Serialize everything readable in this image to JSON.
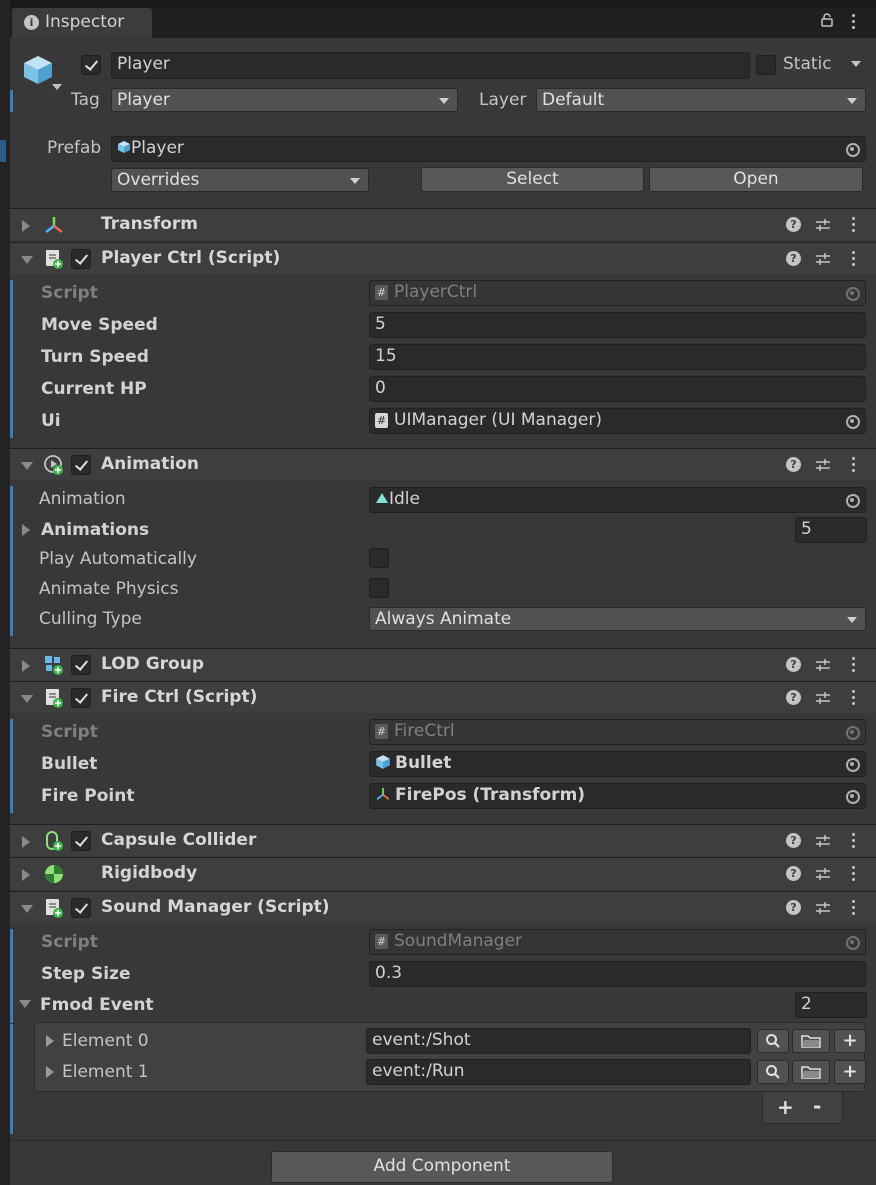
{
  "window": {
    "tab_label": "Inspector"
  },
  "gameobject": {
    "name": "Player",
    "active": true,
    "static_label": "Static",
    "static_checked": false,
    "tag_label": "Tag",
    "tag_value": "Player",
    "layer_label": "Layer",
    "layer_value": "Default",
    "prefab_label": "Prefab",
    "prefab_value": "Player",
    "overrides_label": "Overrides",
    "select_label": "Select",
    "open_label": "Open"
  },
  "components": {
    "transform": {
      "title": "Transform",
      "expanded": false
    },
    "player_ctrl": {
      "title": "Player Ctrl (Script)",
      "script_label": "Script",
      "script_value": "PlayerCtrl",
      "move_speed_label": "Move Speed",
      "move_speed_value": "5",
      "turn_speed_label": "Turn Speed",
      "turn_speed_value": "15",
      "current_hp_label": "Current HP",
      "current_hp_value": "0",
      "ui_label": "Ui",
      "ui_value": "UIManager (UI Manager)"
    },
    "animation": {
      "title": "Animation",
      "animation_label": "Animation",
      "animation_value": "Idle",
      "animations_label": "Animations",
      "animations_count": "5",
      "play_auto_label": "Play Automatically",
      "animate_physics_label": "Animate Physics",
      "culling_label": "Culling Type",
      "culling_value": "Always Animate"
    },
    "lod_group": {
      "title": "LOD Group"
    },
    "fire_ctrl": {
      "title": "Fire Ctrl (Script)",
      "script_label": "Script",
      "script_value": "FireCtrl",
      "bullet_label": "Bullet",
      "bullet_value": "Bullet",
      "fire_point_label": "Fire Point",
      "fire_point_value": "FirePos (Transform)"
    },
    "capsule_collider": {
      "title": "Capsule Collider"
    },
    "rigidbody": {
      "title": "Rigidbody"
    },
    "sound_manager": {
      "title": "Sound Manager (Script)",
      "script_label": "Script",
      "script_value": "SoundManager",
      "step_size_label": "Step Size",
      "step_size_value": "0.3",
      "fmod_event_label": "Fmod Event",
      "fmod_event_count": "2",
      "elements": [
        {
          "label": "Element 0",
          "value": "event:/Shot"
        },
        {
          "label": "Element 1",
          "value": "event:/Run"
        }
      ],
      "add_symbol": "+",
      "remove_symbol": "-"
    }
  },
  "add_component_label": "Add Component",
  "colors": {
    "background": "#383838",
    "header": "#3e3e3e",
    "accent_blue": "#3c7bc0"
  }
}
